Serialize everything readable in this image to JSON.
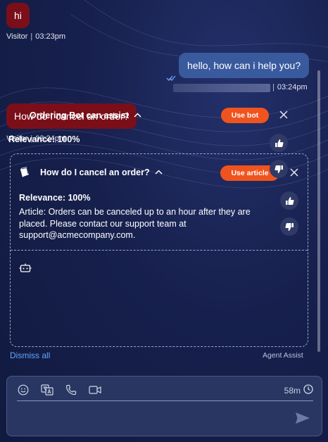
{
  "colors": {
    "visitor_bubble": "#7a0f1a",
    "agent_bubble": "#3a5a9e",
    "accent_button": "#f0541e",
    "link": "#5fa8ff"
  },
  "messages": [
    {
      "sender": "Visitor",
      "text": "hi",
      "time": "03:23pm",
      "separator": "|"
    },
    {
      "sender": "",
      "text": "hello, how can i help you?",
      "time": "03:24pm",
      "separator": "|",
      "read_icon": "double-check-icon"
    },
    {
      "sender": "Visitor",
      "text": "How do I cancel an order?",
      "time": "03:24pm",
      "separator": "|"
    }
  ],
  "assist": {
    "cards": [
      {
        "icon": "book-icon",
        "title": "How do I cancel an order?",
        "button": "Use article",
        "relevance": "Relevance: 100%",
        "body": "Article: Orders can be canceled up to an hour after they are placed. Please contact our support team at support@acmecompany.com."
      },
      {
        "icon": "bot-icon",
        "title": "Ordering Bot can assist",
        "button": "Use bot",
        "relevance": "Relevance: 100%",
        "body": ""
      }
    ],
    "dismiss_all": "Dismiss all",
    "footer_label": "Agent Assist"
  },
  "composer": {
    "icons": [
      "emoji-icon",
      "translate-icon",
      "phone-icon",
      "video-icon"
    ],
    "timer": "58m",
    "timer_icon": "clock-icon",
    "send_icon": "send-icon"
  }
}
